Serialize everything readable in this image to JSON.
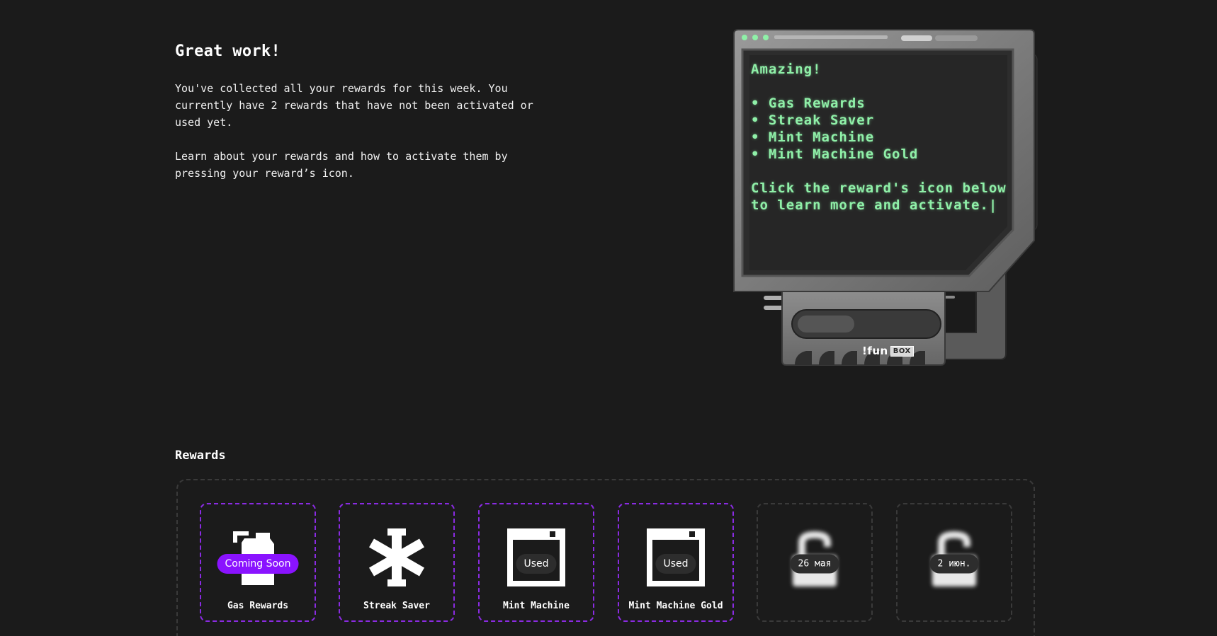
{
  "intro": {
    "title": "Great work!",
    "paragraph1": "You've collected all your rewards for this week. You currently have 2 rewards that have not been activated or used yet.",
    "paragraph2": "Learn about your rewards and how to activate them by pressing your reward’s icon."
  },
  "device": {
    "heading": "Amazing!",
    "items": [
      "Gas Rewards",
      "Streak Saver",
      "Mint Machine",
      "Mint Machine Gold"
    ],
    "cta": "Click the reward's icon below to learn more and activate.",
    "cursor": "|",
    "brand_main": "!fun",
    "brand_box": "BOX"
  },
  "rewards": {
    "title": "Rewards",
    "cards": [
      {
        "label": "Gas Rewards",
        "badge": "Coming Soon",
        "icon": "gas-pump-icon"
      },
      {
        "label": "Streak Saver",
        "badge": "",
        "icon": "snowflake-icon"
      },
      {
        "label": "Mint Machine",
        "badge": "Used",
        "icon": "mint-machine-icon"
      },
      {
        "label": "Mint Machine Gold",
        "badge": "Used",
        "icon": "mint-machine-icon"
      },
      {
        "label": "",
        "badge": "26 мая",
        "icon": "lock-icon"
      },
      {
        "label": "",
        "badge": "2 июн.",
        "icon": "lock-icon"
      }
    ]
  },
  "colors": {
    "background": "#1b1b1b",
    "accent": "#8a13ff",
    "screen_text": "#8ff0a8"
  }
}
